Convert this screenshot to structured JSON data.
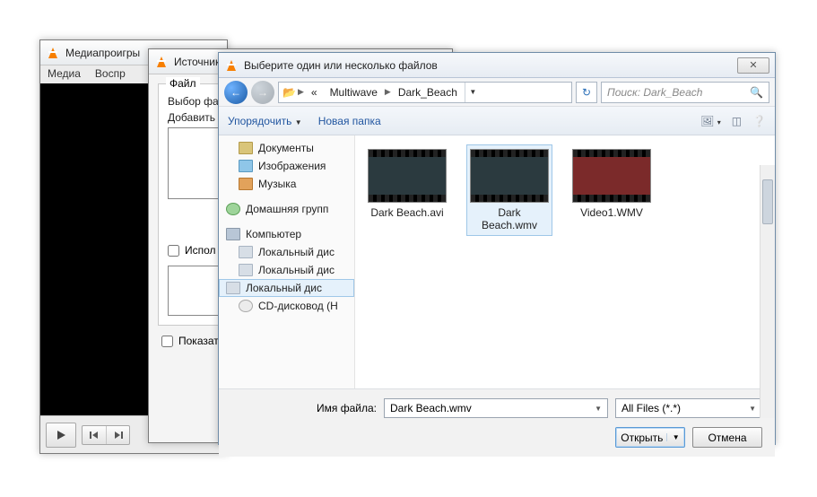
{
  "vlc": {
    "title": "Медиапроигры",
    "menu": {
      "media": "Медиа",
      "playback": "Воспр"
    }
  },
  "source": {
    "title": "Источник",
    "group_file": "Файл",
    "label_select": "Выбор фа",
    "label_add": "Добавить",
    "chk_use": "Испол",
    "chk_show": "Показать"
  },
  "dialog": {
    "title": "Выберите один или несколько файлов",
    "breadcrumb": {
      "sep0": "«",
      "p1": "Multiwave",
      "p2": "Dark_Beach"
    },
    "search_placeholder": "Поиск: Dark_Beach",
    "toolbar": {
      "organize": "Упорядочить",
      "newfolder": "Новая папка"
    },
    "tree": {
      "documents": "Документы",
      "images": "Изображения",
      "music": "Музыка",
      "homegroup": "Домашняя групп",
      "computer": "Компьютер",
      "drive_a": "Локальный дис",
      "drive_b": "Локальный дис",
      "drive_c": "Локальный дис",
      "cd": "CD-дисковод (Н"
    },
    "files": [
      {
        "name": "Dark Beach.avi"
      },
      {
        "name": "Dark Beach.wmv"
      },
      {
        "name": "Video1.WMV"
      }
    ],
    "footer": {
      "name_label": "Имя файла:",
      "name_value": "Dark Beach.wmv",
      "filter": "All Files (*.*)",
      "open": "Открыть",
      "cancel": "Отмена"
    }
  }
}
